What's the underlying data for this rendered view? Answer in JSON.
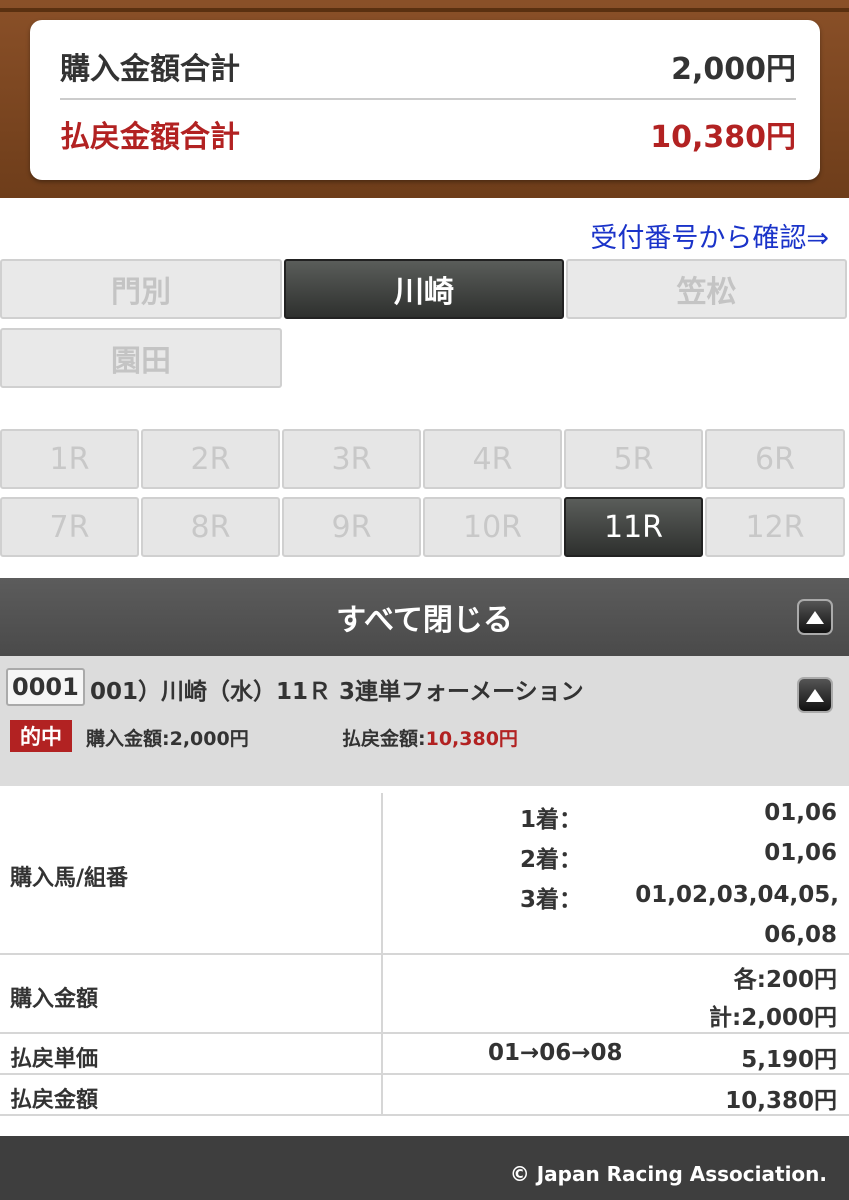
{
  "summary": {
    "purchase_total_label": "購入金額合計",
    "purchase_total_value": "2,000円",
    "payout_total_label": "払戻金額合計",
    "payout_total_value": "10,380円"
  },
  "confirm_link": "受付番号から確認⇒",
  "venues": [
    "門別",
    "川崎",
    "笠松",
    "園田"
  ],
  "races": [
    "1R",
    "2R",
    "3R",
    "4R",
    "5R",
    "6R",
    "7R",
    "8R",
    "9R",
    "10R",
    "11R",
    "12R"
  ],
  "close_all_label": "すべて閉じる",
  "ticket": {
    "number": "0001",
    "title": "001）川崎（水）11Ｒ 3連単フォーメーション",
    "hit_label": "的中",
    "purchase_amount": "購入金額:2,000円",
    "payout_label": "払戻金額:",
    "payout_value": "10,380円"
  },
  "details": {
    "horses_label": "購入馬/組番",
    "place1_label": "1着：",
    "place1_value": "01,06",
    "place2_label": "2着：",
    "place2_value": "01,06",
    "place3_label": "3着：",
    "place3_value_line1": "01,02,03,04,05,",
    "place3_value_line2": "06,08",
    "amount_label": "購入金額",
    "amount_each": "各:200円",
    "amount_total": "計:2,000円",
    "unit_label": "払戻単価",
    "unit_combo": "01→06→08",
    "unit_value": "5,190円",
    "payout_label": "払戻金額",
    "payout_value": "10,380円"
  },
  "footer": "© Japan Racing Association."
}
